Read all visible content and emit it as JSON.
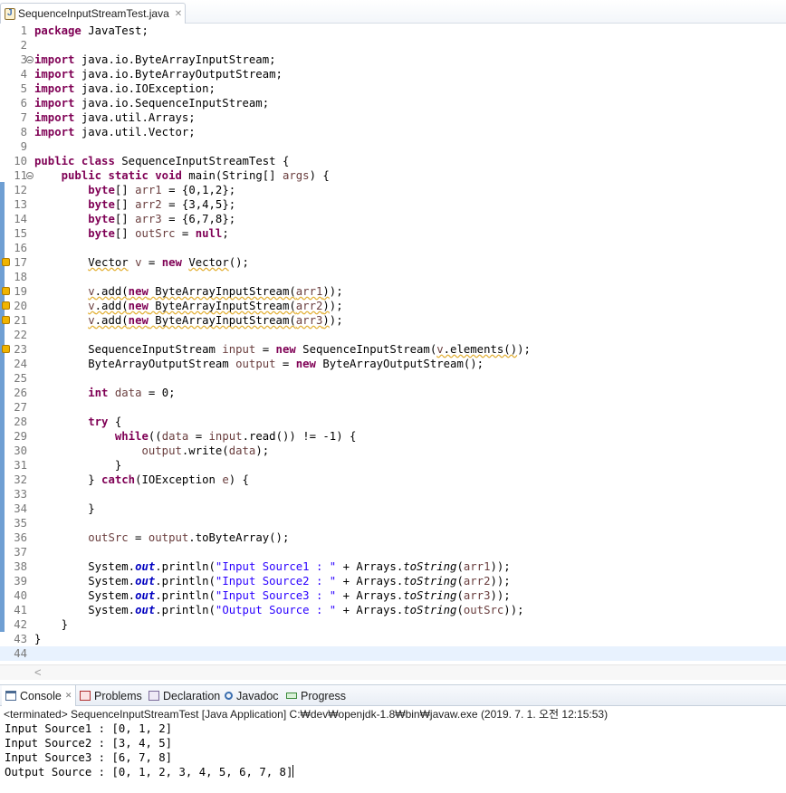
{
  "editor": {
    "tab_title": "SequenceInputStreamTest.java",
    "lines": [
      {
        "n": "1",
        "tokens": [
          {
            "t": "package",
            "c": "kw"
          },
          {
            "t": " JavaTest;"
          }
        ]
      },
      {
        "n": "2",
        "tokens": []
      },
      {
        "n": "3",
        "fold": true,
        "tokens": [
          {
            "t": "import",
            "c": "kw"
          },
          {
            "t": " java.io.ByteArrayInputStream;"
          }
        ]
      },
      {
        "n": "4",
        "tokens": [
          {
            "t": "import",
            "c": "kw"
          },
          {
            "t": " java.io.ByteArrayOutputStream;"
          }
        ]
      },
      {
        "n": "5",
        "tokens": [
          {
            "t": "import",
            "c": "kw"
          },
          {
            "t": " java.io.IOException;"
          }
        ]
      },
      {
        "n": "6",
        "tokens": [
          {
            "t": "import",
            "c": "kw"
          },
          {
            "t": " java.io.SequenceInputStream;"
          }
        ]
      },
      {
        "n": "7",
        "tokens": [
          {
            "t": "import",
            "c": "kw"
          },
          {
            "t": " java.util.Arrays;"
          }
        ]
      },
      {
        "n": "8",
        "tokens": [
          {
            "t": "import",
            "c": "kw"
          },
          {
            "t": " java.util.Vector;"
          }
        ]
      },
      {
        "n": "9",
        "tokens": []
      },
      {
        "n": "10",
        "tokens": [
          {
            "t": "public",
            "c": "kw"
          },
          {
            "t": " "
          },
          {
            "t": "class",
            "c": "kw"
          },
          {
            "t": " SequenceInputStreamTest {"
          }
        ]
      },
      {
        "n": "11",
        "fold": true,
        "tokens": [
          {
            "t": "    "
          },
          {
            "t": "public",
            "c": "kw"
          },
          {
            "t": " "
          },
          {
            "t": "static",
            "c": "kw"
          },
          {
            "t": " "
          },
          {
            "t": "void",
            "c": "kw"
          },
          {
            "t": " main(String[] "
          },
          {
            "t": "args",
            "c": "var"
          },
          {
            "t": ") {"
          }
        ]
      },
      {
        "n": "12",
        "tokens": [
          {
            "t": "        "
          },
          {
            "t": "byte",
            "c": "kw"
          },
          {
            "t": "[] "
          },
          {
            "t": "arr1",
            "c": "var"
          },
          {
            "t": " = {0,1,2};"
          }
        ]
      },
      {
        "n": "13",
        "tokens": [
          {
            "t": "        "
          },
          {
            "t": "byte",
            "c": "kw"
          },
          {
            "t": "[] "
          },
          {
            "t": "arr2",
            "c": "var"
          },
          {
            "t": " = {3,4,5};"
          }
        ]
      },
      {
        "n": "14",
        "tokens": [
          {
            "t": "        "
          },
          {
            "t": "byte",
            "c": "kw"
          },
          {
            "t": "[] "
          },
          {
            "t": "arr3",
            "c": "var"
          },
          {
            "t": " = {6,7,8};"
          }
        ]
      },
      {
        "n": "15",
        "tokens": [
          {
            "t": "        "
          },
          {
            "t": "byte",
            "c": "kw"
          },
          {
            "t": "[] "
          },
          {
            "t": "outSrc",
            "c": "var"
          },
          {
            "t": " = "
          },
          {
            "t": "null",
            "c": "kw"
          },
          {
            "t": ";"
          }
        ]
      },
      {
        "n": "16",
        "tokens": []
      },
      {
        "n": "17",
        "warn": true,
        "tokens": [
          {
            "t": "        "
          },
          {
            "t": "Vector",
            "c": "wavy"
          },
          {
            "t": " "
          },
          {
            "t": "v",
            "c": "var"
          },
          {
            "t": " = "
          },
          {
            "t": "new",
            "c": "kw"
          },
          {
            "t": " "
          },
          {
            "t": "Vector",
            "c": "wavy"
          },
          {
            "t": "();"
          }
        ]
      },
      {
        "n": "18",
        "tokens": []
      },
      {
        "n": "19",
        "warn": true,
        "tokens": [
          {
            "t": "        "
          },
          {
            "t": "v",
            "c": "var wavy"
          },
          {
            "t": ".add(",
            "c": "wavy"
          },
          {
            "t": "new",
            "c": "kw wavy"
          },
          {
            "t": " ByteArrayInputStream(",
            "c": "wavy"
          },
          {
            "t": "arr1",
            "c": "var wavy"
          },
          {
            "t": ")",
            "c": "wavy"
          },
          {
            "t": ");"
          }
        ]
      },
      {
        "n": "20",
        "warn": true,
        "tokens": [
          {
            "t": "        "
          },
          {
            "t": "v",
            "c": "var wavy"
          },
          {
            "t": ".add(",
            "c": "wavy"
          },
          {
            "t": "new",
            "c": "kw wavy"
          },
          {
            "t": " ByteArrayInputStream(",
            "c": "wavy"
          },
          {
            "t": "arr2",
            "c": "var wavy"
          },
          {
            "t": ")",
            "c": "wavy"
          },
          {
            "t": ");"
          }
        ]
      },
      {
        "n": "21",
        "warn": true,
        "tokens": [
          {
            "t": "        "
          },
          {
            "t": "v",
            "c": "var wavy"
          },
          {
            "t": ".add(",
            "c": "wavy"
          },
          {
            "t": "new",
            "c": "kw wavy"
          },
          {
            "t": " ByteArrayInputStream(",
            "c": "wavy"
          },
          {
            "t": "arr3",
            "c": "var wavy"
          },
          {
            "t": ")",
            "c": "wavy"
          },
          {
            "t": ");"
          }
        ]
      },
      {
        "n": "22",
        "tokens": []
      },
      {
        "n": "23",
        "warn": true,
        "tokens": [
          {
            "t": "        SequenceInputStream "
          },
          {
            "t": "input",
            "c": "var"
          },
          {
            "t": " = "
          },
          {
            "t": "new",
            "c": "kw"
          },
          {
            "t": " SequenceInputStream("
          },
          {
            "t": "v",
            "c": "var wavy"
          },
          {
            "t": ".elements()",
            "c": "wavy"
          },
          {
            "t": ");"
          }
        ]
      },
      {
        "n": "24",
        "tokens": [
          {
            "t": "        ByteArrayOutputStream "
          },
          {
            "t": "output",
            "c": "var"
          },
          {
            "t": " = "
          },
          {
            "t": "new",
            "c": "kw"
          },
          {
            "t": " ByteArrayOutputStream();"
          }
        ]
      },
      {
        "n": "25",
        "tokens": []
      },
      {
        "n": "26",
        "tokens": [
          {
            "t": "        "
          },
          {
            "t": "int",
            "c": "kw"
          },
          {
            "t": " "
          },
          {
            "t": "data",
            "c": "var"
          },
          {
            "t": " = 0;"
          }
        ]
      },
      {
        "n": "27",
        "tokens": []
      },
      {
        "n": "28",
        "tokens": [
          {
            "t": "        "
          },
          {
            "t": "try",
            "c": "kw"
          },
          {
            "t": " {"
          }
        ]
      },
      {
        "n": "29",
        "tokens": [
          {
            "t": "            "
          },
          {
            "t": "while",
            "c": "kw"
          },
          {
            "t": "(("
          },
          {
            "t": "data",
            "c": "var"
          },
          {
            "t": " = "
          },
          {
            "t": "input",
            "c": "var"
          },
          {
            "t": ".read()) != -1) {"
          }
        ]
      },
      {
        "n": "30",
        "tokens": [
          {
            "t": "                "
          },
          {
            "t": "output",
            "c": "var"
          },
          {
            "t": ".write("
          },
          {
            "t": "data",
            "c": "var"
          },
          {
            "t": ");"
          }
        ]
      },
      {
        "n": "31",
        "tokens": [
          {
            "t": "            }"
          }
        ]
      },
      {
        "n": "32",
        "tokens": [
          {
            "t": "        } "
          },
          {
            "t": "catch",
            "c": "kw"
          },
          {
            "t": "(IOException "
          },
          {
            "t": "e",
            "c": "var"
          },
          {
            "t": ") {"
          }
        ]
      },
      {
        "n": "33",
        "tokens": []
      },
      {
        "n": "34",
        "tokens": [
          {
            "t": "        }"
          }
        ]
      },
      {
        "n": "35",
        "tokens": []
      },
      {
        "n": "36",
        "tokens": [
          {
            "t": "        "
          },
          {
            "t": "outSrc",
            "c": "var"
          },
          {
            "t": " = "
          },
          {
            "t": "output",
            "c": "var"
          },
          {
            "t": ".toByteArray();"
          }
        ]
      },
      {
        "n": "37",
        "tokens": []
      },
      {
        "n": "38",
        "tokens": [
          {
            "t": "        System."
          },
          {
            "t": "out",
            "c": "fld"
          },
          {
            "t": ".println("
          },
          {
            "t": "\"Input Source1 : \"",
            "c": "str"
          },
          {
            "t": " + Arrays."
          },
          {
            "t": "toString",
            "c": "ital"
          },
          {
            "t": "("
          },
          {
            "t": "arr1",
            "c": "var"
          },
          {
            "t": "));"
          }
        ]
      },
      {
        "n": "39",
        "tokens": [
          {
            "t": "        System."
          },
          {
            "t": "out",
            "c": "fld"
          },
          {
            "t": ".println("
          },
          {
            "t": "\"Input Source2 : \"",
            "c": "str"
          },
          {
            "t": " + Arrays."
          },
          {
            "t": "toString",
            "c": "ital"
          },
          {
            "t": "("
          },
          {
            "t": "arr2",
            "c": "var"
          },
          {
            "t": "));"
          }
        ]
      },
      {
        "n": "40",
        "tokens": [
          {
            "t": "        System."
          },
          {
            "t": "out",
            "c": "fld"
          },
          {
            "t": ".println("
          },
          {
            "t": "\"Input Source3 : \"",
            "c": "str"
          },
          {
            "t": " + Arrays."
          },
          {
            "t": "toString",
            "c": "ital"
          },
          {
            "t": "("
          },
          {
            "t": "arr3",
            "c": "var"
          },
          {
            "t": "));"
          }
        ]
      },
      {
        "n": "41",
        "tokens": [
          {
            "t": "        System."
          },
          {
            "t": "out",
            "c": "fld"
          },
          {
            "t": ".println("
          },
          {
            "t": "\"Output Source : \"",
            "c": "str"
          },
          {
            "t": " + Arrays."
          },
          {
            "t": "toString",
            "c": "ital"
          },
          {
            "t": "("
          },
          {
            "t": "outSrc",
            "c": "var"
          },
          {
            "t": "));"
          }
        ]
      },
      {
        "n": "42",
        "tokens": [
          {
            "t": "    }"
          }
        ]
      },
      {
        "n": "43",
        "tokens": [
          {
            "t": "}"
          }
        ]
      },
      {
        "n": "44",
        "current": true,
        "tokens": []
      }
    ]
  },
  "scrollbar": {
    "left_arrow": "<"
  },
  "console_view": {
    "tabs": [
      {
        "label": "Console",
        "icon": "console-icon",
        "close": "✕"
      },
      {
        "label": "Problems",
        "icon": "problems-icon"
      },
      {
        "label": "Declaration",
        "icon": "declaration-icon"
      },
      {
        "label": "Javadoc",
        "icon": "javadoc-icon"
      },
      {
        "label": "Progress",
        "icon": "progress-icon"
      }
    ],
    "description": "<terminated> SequenceInputStreamTest [Java Application] C:₩dev₩openjdk-1.8₩bin₩javaw.exe (2019. 7. 1. 오전 12:15:53)",
    "output": [
      "Input Source1 : [0, 1, 2]",
      "Input Source2 : [3, 4, 5]",
      "Input Source3 : [6, 7, 8]",
      "Output Source : [0, 1, 2, 3, 4, 5, 6, 7, 8]"
    ]
  },
  "colors": {
    "keyword": "#7f0055",
    "string": "#2a00ff",
    "local_variable": "#6a3e3e",
    "static_field": "#0000c0",
    "warning": "#e3b23b",
    "current_line": "#e8f2fe",
    "ruler": "#6f9fd3"
  },
  "tab_close_glyph": "✕"
}
